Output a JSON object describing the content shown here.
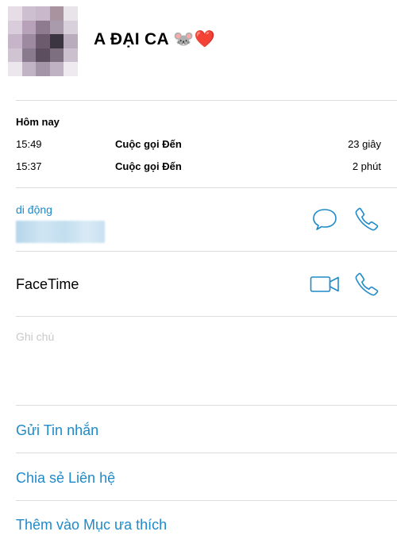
{
  "contact": {
    "name": "A ĐẠI CA 🐭❤️"
  },
  "recent": {
    "title": "Hôm nay",
    "calls": [
      {
        "time": "15:49",
        "type": "Cuộc gọi Đến",
        "duration": "23 giây"
      },
      {
        "time": "15:37",
        "type": "Cuộc gọi Đến",
        "duration": "2 phút"
      }
    ]
  },
  "phone": {
    "label": "di động"
  },
  "facetime": {
    "label": "FaceTime"
  },
  "notes": {
    "label": "Ghi chú"
  },
  "actions": {
    "send_message": "Gửi Tin nhắn",
    "share_contact": "Chia sẻ Liên hệ",
    "add_favorite": "Thêm vào Mục ưa thích"
  },
  "icons": {
    "message": "speech-bubble-icon",
    "phone": "phone-handset-icon",
    "video": "video-camera-icon"
  },
  "colors": {
    "accent": "#1f8ac9",
    "divider": "#dcdcdc",
    "placeholder": "#c8c8c8"
  }
}
